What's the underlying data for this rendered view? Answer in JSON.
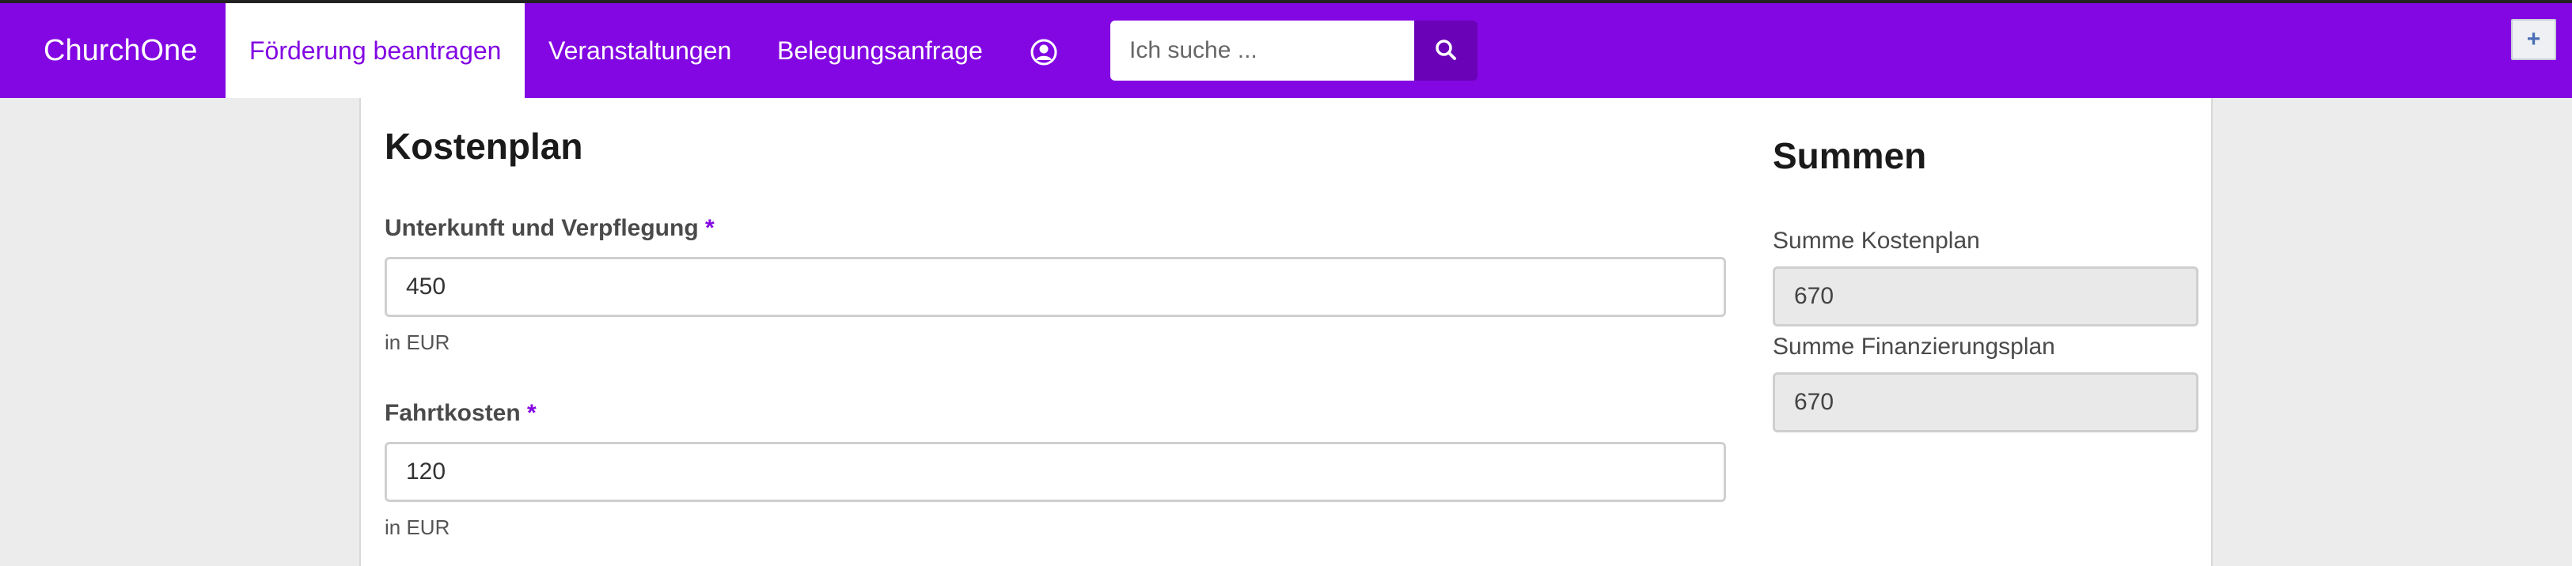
{
  "navbar": {
    "brand": "ChurchOne",
    "items": [
      {
        "label": "Förderung beantragen",
        "active": true
      },
      {
        "label": "Veranstaltungen",
        "active": false
      },
      {
        "label": "Belegungsanfrage",
        "active": false
      }
    ],
    "user_icon": "user-circle-icon",
    "search": {
      "placeholder": "Ich suche ...",
      "value": "",
      "icon": "search-icon"
    },
    "plus_button": {
      "label": "+"
    }
  },
  "kostenplan": {
    "title": "Kostenplan",
    "fields": [
      {
        "label": "Unterkunft und Verpflegung",
        "required_mark": "*",
        "value": "450",
        "help": "in EUR"
      },
      {
        "label": "Fahrtkosten",
        "required_mark": "*",
        "value": "120",
        "help": "in EUR"
      }
    ]
  },
  "summen": {
    "title": "Summen",
    "fields": [
      {
        "label": "Summe Kostenplan",
        "value": "670"
      },
      {
        "label": "Summe Finanzierungsplan",
        "value": "670"
      }
    ]
  },
  "colors": {
    "brand": "#8307e2",
    "search_button": "#6a03b8",
    "background": "#ececec",
    "readonly_field": "#e9e9e9"
  }
}
